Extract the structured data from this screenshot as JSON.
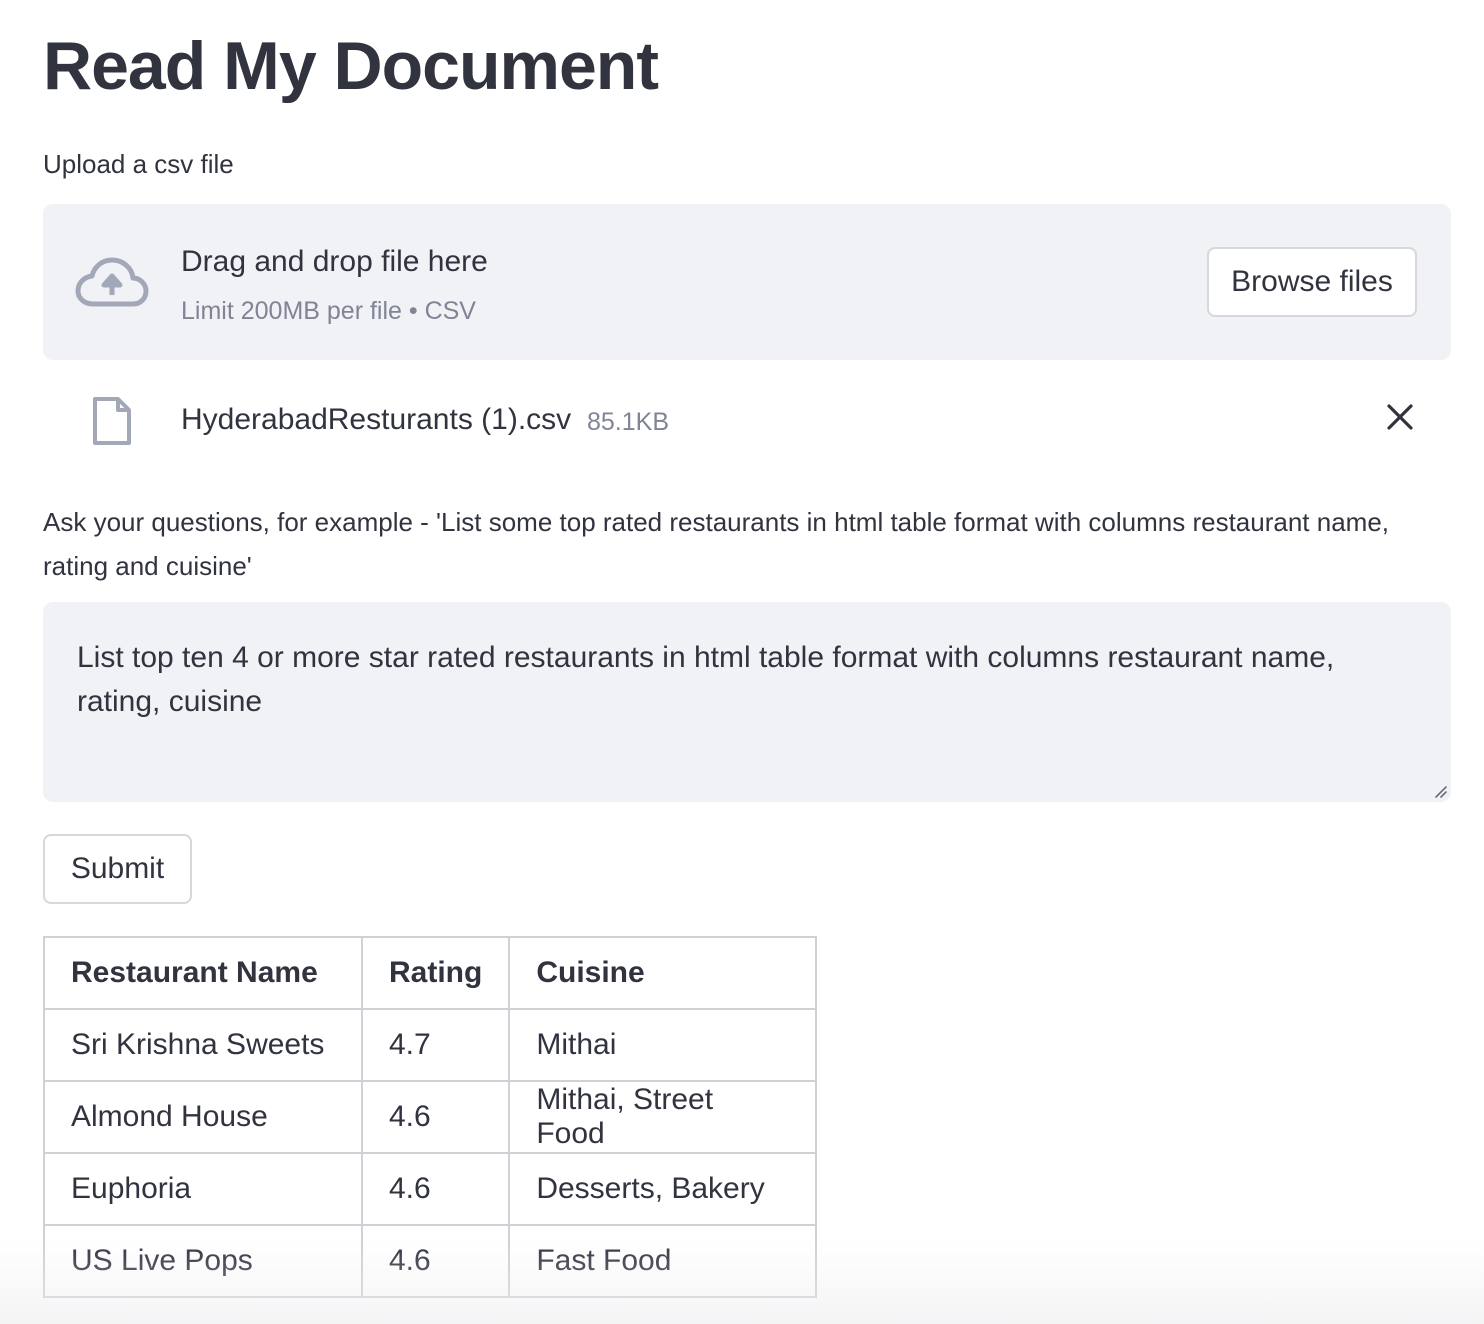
{
  "page": {
    "title": "Read My Document"
  },
  "uploader": {
    "label": "Upload a csv file",
    "drop_text": "Drag and drop file here",
    "limit_text": "Limit 200MB per file • CSV",
    "browse_label": "Browse files",
    "icon": "cloud-upload-icon"
  },
  "uploaded_file": {
    "name": "HyderabadResturants (1).csv",
    "size": "85.1KB",
    "icon": "file-icon",
    "remove_icon": "close-icon"
  },
  "question": {
    "label": "Ask your questions, for example - 'List some top rated restaurants in html table format with columns restaurant name, rating and cuisine'",
    "value": "List top ten 4 or more star rated restaurants in html table format with columns restaurant name, rating, cuisine"
  },
  "submit": {
    "label": "Submit"
  },
  "results": {
    "headers": [
      "Restaurant Name",
      "Rating",
      "Cuisine"
    ],
    "rows": [
      [
        "Sri Krishna Sweets",
        "4.7",
        "Mithai"
      ],
      [
        "Almond House",
        "4.6",
        "Mithai, Street Food"
      ],
      [
        "Euphoria",
        "4.6",
        "Desserts, Bakery"
      ],
      [
        "US Live Pops",
        "4.6",
        "Fast Food"
      ]
    ]
  },
  "colors": {
    "text": "#31333f",
    "muted": "#808495",
    "panel": "#f0f2f6",
    "border": "#d6d8de"
  }
}
